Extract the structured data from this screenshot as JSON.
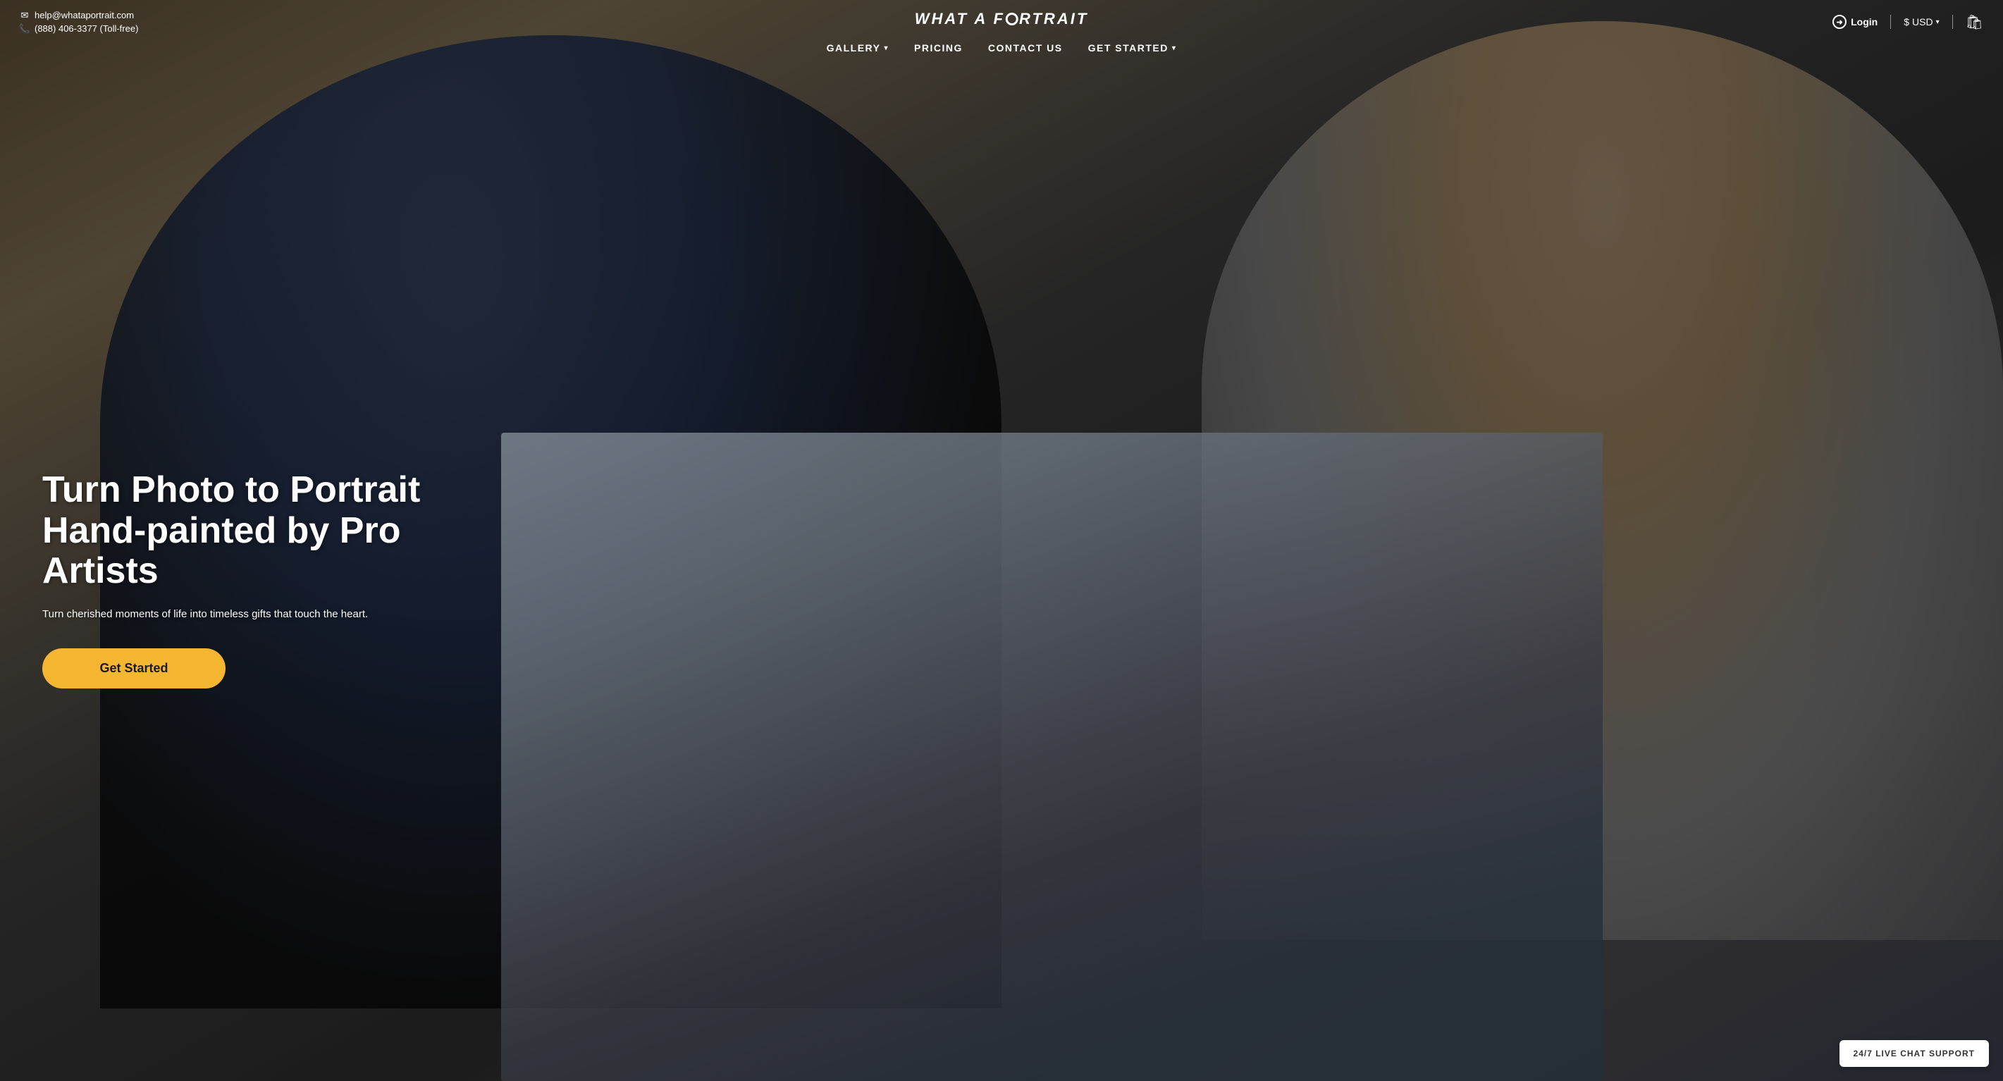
{
  "site": {
    "logo": "WHAT A PORTRAIT"
  },
  "topbar": {
    "email": "help@whataportrait.com",
    "phone": "(888) 406-3377 (Toll-free)",
    "login_label": "Login",
    "currency_label": "USD",
    "currency_symbol": "$"
  },
  "nav": {
    "items": [
      {
        "id": "gallery",
        "label": "GALLERY",
        "has_dropdown": true
      },
      {
        "id": "pricing",
        "label": "PRICING",
        "has_dropdown": false
      },
      {
        "id": "contact",
        "label": "CONTACT US",
        "has_dropdown": false
      },
      {
        "id": "get-started",
        "label": "GET STARTED",
        "has_dropdown": true
      }
    ]
  },
  "hero": {
    "title_line1": "Turn Photo to Portrait",
    "title_line2": "Hand-painted by Pro",
    "title_line3": "Artists",
    "subtitle": "Turn cherished moments of life into timeless gifts that touch the heart.",
    "cta_label": "Get Started"
  },
  "live_chat": {
    "label": "24/7 LIVE CHAT SUPPORT"
  }
}
